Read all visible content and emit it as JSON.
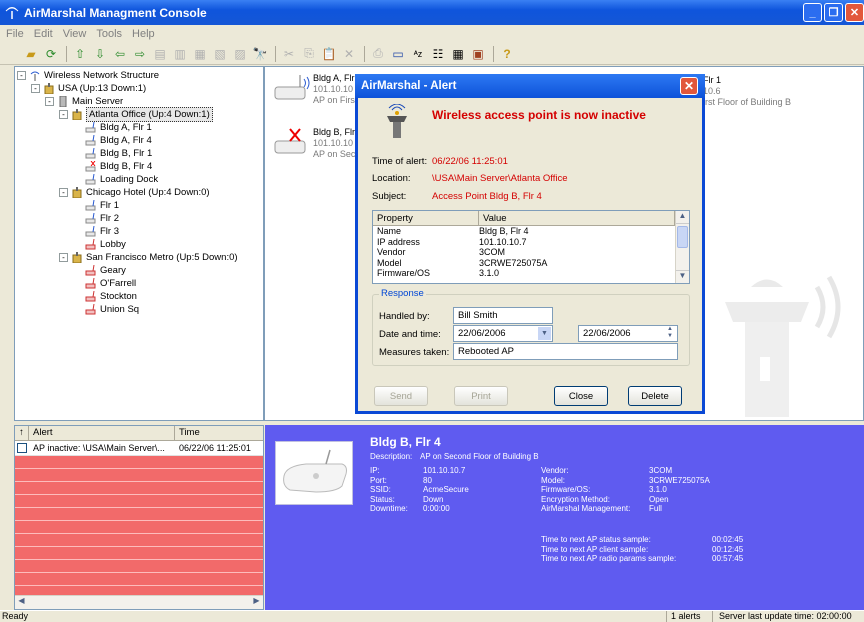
{
  "window": {
    "title": "AirMarshal Managment Console"
  },
  "menu": [
    "File",
    "Edit",
    "View",
    "Tools",
    "Help"
  ],
  "tree": [
    {
      "label": "Wireless Network Structure",
      "indent": 0,
      "exp": "-",
      "icon": "antenna"
    },
    {
      "label": "USA (Up:13 Down:1)",
      "indent": 1,
      "exp": "-",
      "icon": "building"
    },
    {
      "label": "Main Server",
      "indent": 2,
      "exp": "-",
      "icon": "server"
    },
    {
      "label": "Atlanta Office (Up:4 Down:1)",
      "indent": 3,
      "exp": "-",
      "icon": "building",
      "selected": true
    },
    {
      "label": "Bldg A, Flr 1",
      "indent": 4,
      "icon": "ap"
    },
    {
      "label": "Bldg A, Flr 4",
      "indent": 4,
      "icon": "ap"
    },
    {
      "label": "Bldg B, Flr 1",
      "indent": 4,
      "icon": "ap"
    },
    {
      "label": "Bldg B, Flr 4",
      "indent": 4,
      "icon": "ap-down"
    },
    {
      "label": "Loading Dock",
      "indent": 4,
      "icon": "ap"
    },
    {
      "label": "Chicago Hotel (Up:4 Down:0)",
      "indent": 3,
      "exp": "-",
      "icon": "building"
    },
    {
      "label": "Flr 1",
      "indent": 4,
      "icon": "ap"
    },
    {
      "label": "Flr 2",
      "indent": 4,
      "icon": "ap"
    },
    {
      "label": "Flr 3",
      "indent": 4,
      "icon": "ap"
    },
    {
      "label": "Lobby",
      "indent": 4,
      "icon": "ap-red"
    },
    {
      "label": "San Francisco Metro (Up:5 Down:0)",
      "indent": 3,
      "exp": "-",
      "icon": "building"
    },
    {
      "label": "Geary",
      "indent": 4,
      "icon": "ap-red"
    },
    {
      "label": "O'Farrell",
      "indent": 4,
      "icon": "ap-red"
    },
    {
      "label": "Stockton",
      "indent": 4,
      "icon": "ap-red"
    },
    {
      "label": "Union Sq",
      "indent": 4,
      "icon": "ap-red"
    }
  ],
  "cards": {
    "a1": {
      "label": "Bldg A, Flr",
      "ip": "101.10.10",
      "desc": "AP on First"
    },
    "b4": {
      "label": "Bldg B, Flr",
      "ip": "101.10.10",
      "desc": "AP on Seco"
    },
    "right": {
      "label": "Flr 1",
      "ip": "10.6",
      "desc": "irst Floor of Building B"
    }
  },
  "dialog": {
    "title": "AirMarshal - Alert",
    "heading": "Wireless access point is now inactive",
    "time_label": "Time of alert:",
    "time_value": "06/22/06 11:25:01",
    "location_label": "Location:",
    "location_value": "\\USA\\Main Server\\Atlanta Office",
    "subject_label": "Subject:",
    "subject_value": "Access Point Bldg B, Flr 4",
    "prop_header": "Property",
    "value_header": "Value",
    "props": [
      {
        "k": "Name",
        "v": "Bldg B, Flr 4"
      },
      {
        "k": "IP address",
        "v": "101.10.10.7"
      },
      {
        "k": "Vendor",
        "v": "3COM"
      },
      {
        "k": "Model",
        "v": "3CRWE725075A"
      },
      {
        "k": "Firmware/OS",
        "v": "3.1.0"
      }
    ],
    "response_legend": "Response",
    "handled_label": "Handled by:",
    "handled_value": "Bill Smith",
    "datetime_label": "Date and time:",
    "date1": "22/06/2006",
    "date2": "22/06/2006",
    "measures_label": "Measures taken:",
    "measures_value": "Rebooted AP",
    "send": "Send",
    "print": "Print",
    "close": "Close",
    "delete": "Delete"
  },
  "alerts": {
    "col_alert": "Alert",
    "col_time": "Time",
    "rows": [
      {
        "alert": "AP inactive: \\USA\\Main Server\\...",
        "time": "06/22/06 11:25:01"
      }
    ]
  },
  "detail": {
    "title": "Bldg B, Flr 4",
    "desc_label": "Description:",
    "desc_value": "AP on Second Floor of Building B",
    "left": [
      {
        "k": "IP:",
        "v": "101.10.10.7"
      },
      {
        "k": "Port:",
        "v": "80"
      },
      {
        "k": "SSID:",
        "v": "AcmeSecure"
      },
      {
        "k": "Status:",
        "v": "Down"
      },
      {
        "k": "Downtime:",
        "v": "0:00:00"
      }
    ],
    "right": [
      {
        "k": "Vendor:",
        "v": "3COM"
      },
      {
        "k": "Model:",
        "v": "3CRWE725075A"
      },
      {
        "k": "Firmware/OS:",
        "v": "3.1.0"
      },
      {
        "k": "Encryption Method:",
        "v": "Open"
      },
      {
        "k": "AirMarshal Management:",
        "v": "Full"
      }
    ],
    "timers": [
      {
        "k": "Time to next AP status sample:",
        "v": "00:02:45"
      },
      {
        "k": "Time to next AP client sample:",
        "v": "00:12:45"
      },
      {
        "k": "Time to next AP radio params sample:",
        "v": "00:57:45"
      }
    ]
  },
  "status": {
    "left": "Ready",
    "alerts": "1 alerts",
    "server": "Server last update time: 02:00:00"
  },
  "colors": {
    "detail_bg": "#5f5bf0",
    "alert_bg": "#f26a6a",
    "accent_red": "#d40000"
  }
}
